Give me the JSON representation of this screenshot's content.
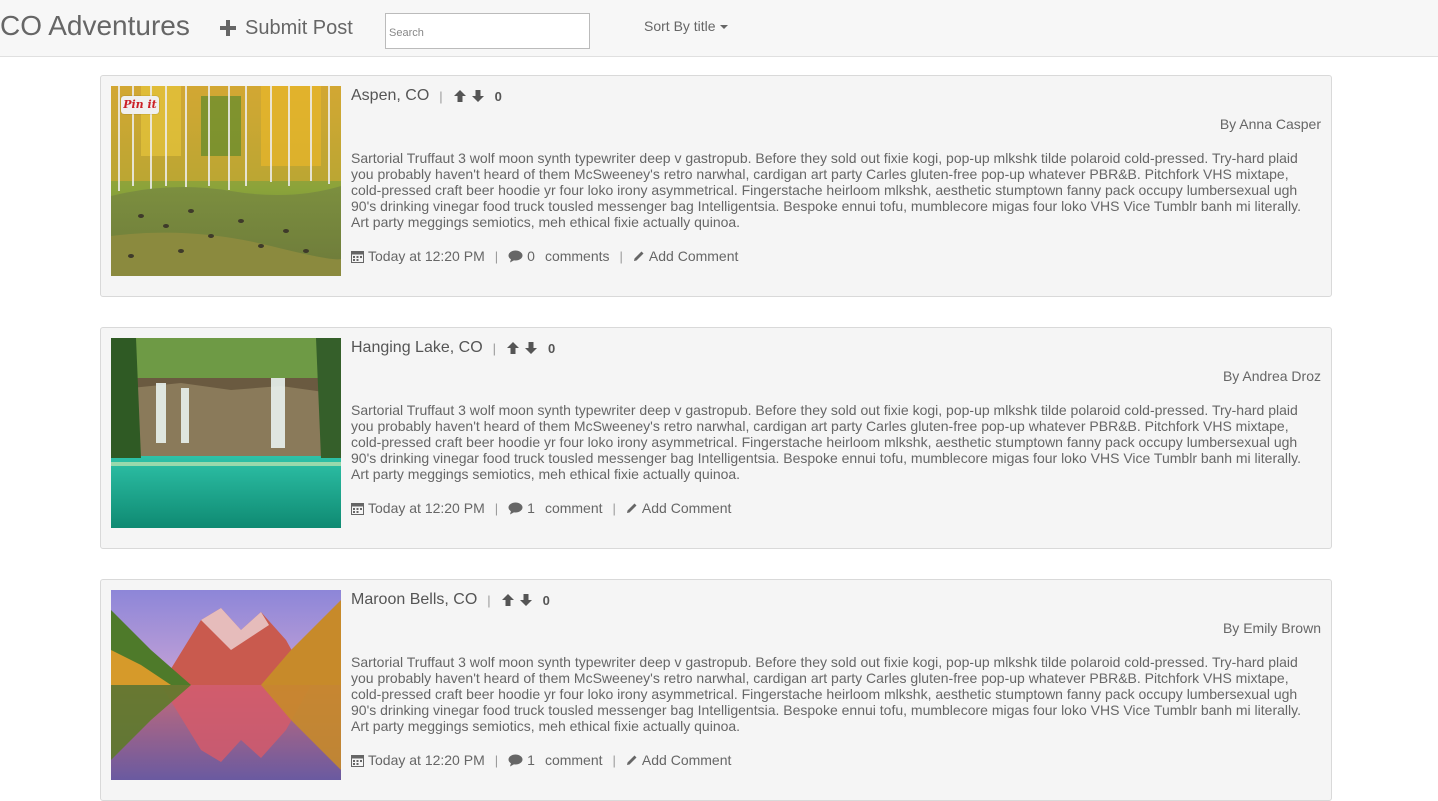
{
  "nav": {
    "brand": "CO Adventures",
    "submit_label": "Submit Post",
    "search_placeholder": "Search",
    "sort_label": "Sort By title"
  },
  "icons": {
    "submit": "plus-icon",
    "sort": "caret-down-icon",
    "upvote": "arrow-up-icon",
    "downvote": "arrow-down-icon",
    "date": "calendar-icon",
    "comments": "comment-bubble-icon",
    "add_comment": "pencil-icon"
  },
  "pinit_label": "Pin it",
  "posts": [
    {
      "title": "Aspen, CO",
      "score": "0",
      "author": "By Anna Casper",
      "body": "Sartorial Truffaut 3 wolf moon synth typewriter deep v gastropub. Before they sold out fixie kogi, pop-up mlkshk tilde polaroid cold-pressed. Try-hard plaid you probably haven't heard of them McSweeney's retro narwhal, cardigan art party Carles gluten-free pop-up whatever PBR&B. Pitchfork VHS mixtape, cold-pressed craft beer hoodie yr four loko irony asymmetrical. Fingerstache heirloom mlkshk, aesthetic stumptown fanny pack occupy lumbersexual ugh 90's drinking vinegar food truck tousled messenger bag Intelligentsia. Bespoke ennui tofu, mumblecore migas four loko VHS Vice Tumblr banh mi literally. Art party meggings semiotics, meh ethical fixie actually quinoa.",
      "date": "Today at 12:20 PM",
      "comment_count": "0",
      "comment_word": "comments",
      "add_comment": "Add Comment"
    },
    {
      "title": "Hanging Lake, CO",
      "score": "0",
      "author": "By Andrea Droz",
      "body": "Sartorial Truffaut 3 wolf moon synth typewriter deep v gastropub. Before they sold out fixie kogi, pop-up mlkshk tilde polaroid cold-pressed. Try-hard plaid you probably haven't heard of them McSweeney's retro narwhal, cardigan art party Carles gluten-free pop-up whatever PBR&B. Pitchfork VHS mixtape, cold-pressed craft beer hoodie yr four loko irony asymmetrical. Fingerstache heirloom mlkshk, aesthetic stumptown fanny pack occupy lumbersexual ugh 90's drinking vinegar food truck tousled messenger bag Intelligentsia. Bespoke ennui tofu, mumblecore migas four loko VHS Vice Tumblr banh mi literally. Art party meggings semiotics, meh ethical fixie actually quinoa.",
      "date": "Today at 12:20 PM",
      "comment_count": "1",
      "comment_word": "comment",
      "add_comment": "Add Comment"
    },
    {
      "title": "Maroon Bells, CO",
      "score": "0",
      "author": "By Emily Brown",
      "body": "Sartorial Truffaut 3 wolf moon synth typewriter deep v gastropub. Before they sold out fixie kogi, pop-up mlkshk tilde polaroid cold-pressed. Try-hard plaid you probably haven't heard of them McSweeney's retro narwhal, cardigan art party Carles gluten-free pop-up whatever PBR&B. Pitchfork VHS mixtape, cold-pressed craft beer hoodie yr four loko irony asymmetrical. Fingerstache heirloom mlkshk, aesthetic stumptown fanny pack occupy lumbersexual ugh 90's drinking vinegar food truck tousled messenger bag Intelligentsia. Bespoke ennui tofu, mumblecore migas four loko VHS Vice Tumblr banh mi literally. Art party meggings semiotics, meh ethical fixie actually quinoa.",
      "date": "Today at 12:20 PM",
      "comment_count": "1",
      "comment_word": "comment",
      "add_comment": "Add Comment"
    }
  ]
}
